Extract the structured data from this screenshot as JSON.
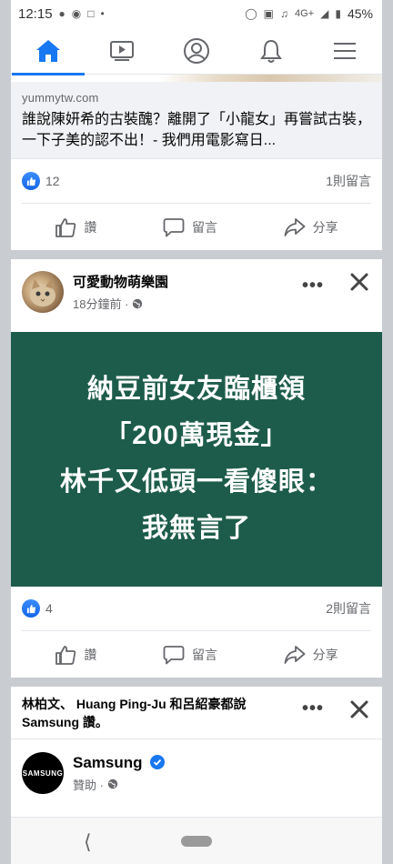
{
  "status": {
    "time": "12:15",
    "network": "4G+",
    "battery": "45%"
  },
  "nav": {
    "tabs": [
      "home",
      "video",
      "profile",
      "notifications",
      "menu"
    ]
  },
  "post1": {
    "domain": "yummytw.com",
    "title": "誰說陳妍希的古裝醜？離開了「小龍女」再嘗試古裝，一下子美的認不出！- 我們用電影寫日...",
    "likes": "12",
    "comments": "1則留言"
  },
  "actions": {
    "like": "讚",
    "comment": "留言",
    "share": "分享"
  },
  "post2": {
    "page_name": "可愛動物萌樂園",
    "time": "18分鐘前 ·",
    "banner_lines": [
      "納豆前女友臨櫃領",
      "「200萬現金」",
      "林千又低頭一看傻眼：",
      "我無言了"
    ],
    "likes": "4",
    "comments": "2則留言"
  },
  "post3": {
    "social_line1": "林柏文、 Huang Ping-Ju 和呂紹豪都說",
    "social_line2": "Samsung 讚。",
    "name": "Samsung",
    "sponsored": "贊助 ·",
    "avatar_text": "SAMSUNG"
  },
  "colors": {
    "accent": "#1877f2",
    "banner_bg": "#1d5c4a",
    "divider": "#c9ccd1"
  }
}
